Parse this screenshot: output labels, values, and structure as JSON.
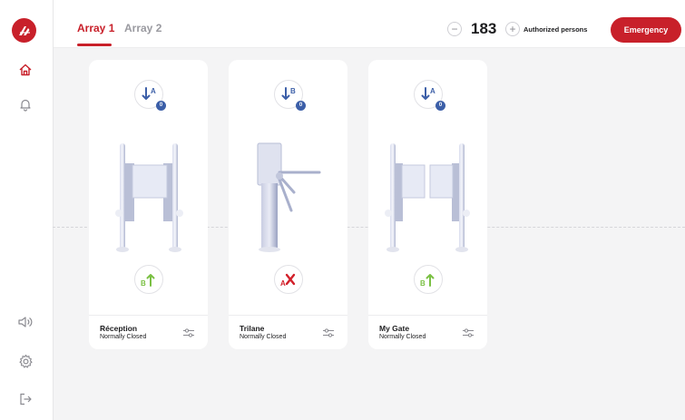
{
  "header": {
    "tabs": [
      {
        "label": "Array 1",
        "active": true
      },
      {
        "label": "Array 2",
        "active": false
      }
    ],
    "counter": {
      "minus": "−",
      "value": "183",
      "plus": "+",
      "label": "Authorized persons"
    },
    "emergency_label": "Emergency"
  },
  "sidebar": {
    "items": [
      {
        "icon": "home-icon"
      },
      {
        "icon": "bell-icon"
      },
      {
        "icon": "speaker-icon"
      },
      {
        "icon": "gear-icon"
      },
      {
        "icon": "logout-icon"
      }
    ]
  },
  "colors": {
    "accent": "#c8202a",
    "badge": "#3c5fa8",
    "allow": "#7ac043",
    "deny": "#d2202a"
  },
  "gates": [
    {
      "name": "Réception",
      "status": "Normally Closed",
      "type": "swing-gate",
      "top": {
        "letter": "A",
        "count": "0"
      },
      "bottom": {
        "letter": "B",
        "state": "allowed"
      }
    },
    {
      "name": "Trilane",
      "status": "Normally Closed",
      "type": "tripod-turnstile",
      "top": {
        "letter": "B",
        "count": "0"
      },
      "bottom": {
        "letter": "A",
        "state": "denied"
      }
    },
    {
      "name": "My Gate",
      "status": "Normally Closed",
      "type": "swing-gate",
      "top": {
        "letter": "A",
        "count": "0"
      },
      "bottom": {
        "letter": "B",
        "state": "allowed"
      }
    }
  ]
}
